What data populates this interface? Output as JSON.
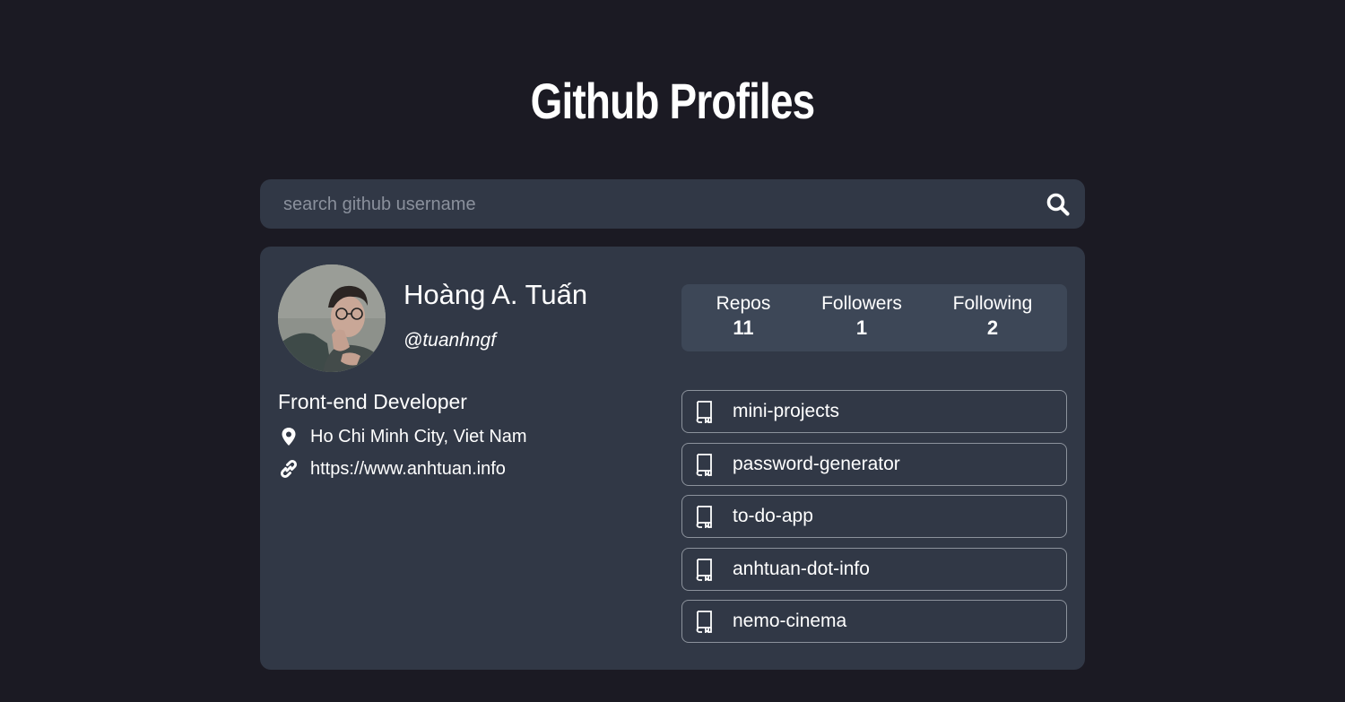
{
  "header": {
    "title": "Github Profiles"
  },
  "search": {
    "placeholder": "search github username",
    "value": "",
    "icon": "search-icon"
  },
  "profile": {
    "name": "Hoàng A. Tuấn",
    "login": "@tuanhngf",
    "bio": "Front-end Developer",
    "location": "Ho Chi Minh City, Viet Nam",
    "website": "https://www.anhtuan.info"
  },
  "stats": [
    {
      "label": "Repos",
      "value": "11"
    },
    {
      "label": "Followers",
      "value": "1"
    },
    {
      "label": "Following",
      "value": "2"
    }
  ],
  "repos": [
    {
      "name": "mini-projects",
      "icon": "book-icon"
    },
    {
      "name": "password-generator",
      "icon": "book-icon"
    },
    {
      "name": "to-do-app",
      "icon": "book-icon"
    },
    {
      "name": "anhtuan-dot-info",
      "icon": "book-icon"
    },
    {
      "name": "nemo-cinema",
      "icon": "book-icon"
    }
  ],
  "colors": {
    "background": "#1b1a23",
    "card": "#313846",
    "stats_bg": "#3d4757",
    "text": "#ffffff",
    "placeholder": "#8a909c",
    "border": "#8c929c"
  }
}
